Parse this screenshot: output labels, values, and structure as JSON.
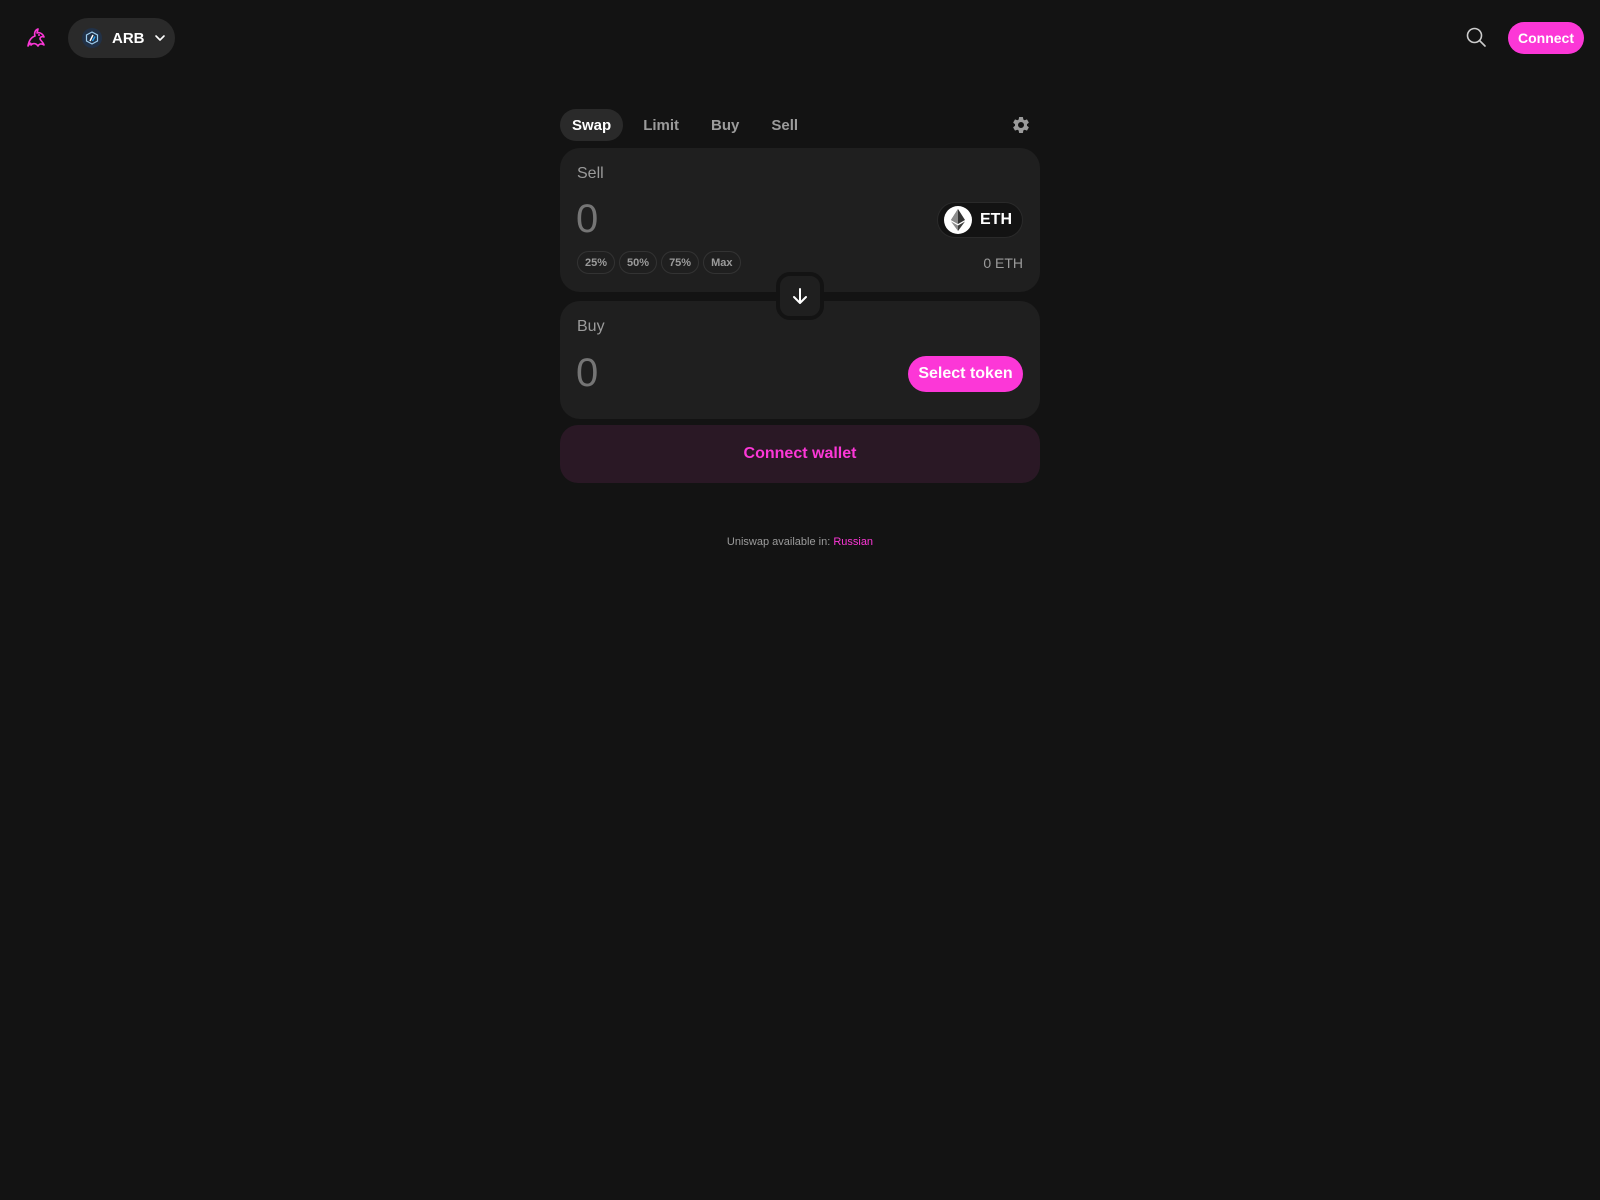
{
  "header": {
    "logo_icon": "uniswap-unicorn-icon",
    "chain": {
      "label": "ARB",
      "icon": "arbitrum-icon"
    },
    "search_icon": "search-icon",
    "connect_label": "Connect"
  },
  "tabs": [
    {
      "label": "Swap",
      "active": true
    },
    {
      "label": "Limit",
      "active": false
    },
    {
      "label": "Buy",
      "active": false
    },
    {
      "label": "Sell",
      "active": false
    }
  ],
  "settings_icon": "gear-icon",
  "sell": {
    "label": "Sell",
    "amount": "0",
    "token": {
      "symbol": "ETH",
      "icon": "ethereum-icon"
    },
    "percent_buttons": [
      "25%",
      "50%",
      "75%",
      "Max"
    ],
    "balance": "0 ETH"
  },
  "switch_icon": "arrow-down-icon",
  "buy": {
    "label": "Buy",
    "amount": "0",
    "select_token_label": "Select token"
  },
  "connect_wallet_label": "Connect wallet",
  "footer": {
    "text": "Uniswap available in: ",
    "language": "Russian"
  },
  "colors": {
    "background": "#131313",
    "panel": "#1f1f1f",
    "accent": "#fc37d7",
    "muted_text": "#9b9b9b",
    "connect_wallet_bg": "#2a1825"
  }
}
